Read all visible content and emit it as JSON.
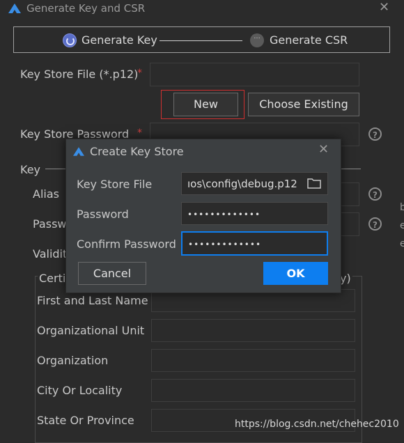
{
  "window": {
    "title": "Generate Key and CSR",
    "close": "✕"
  },
  "steps": [
    {
      "label": "Generate Key",
      "state": "current"
    },
    {
      "label": "Generate CSR",
      "state": "pending",
      "glyph": "···"
    }
  ],
  "form": {
    "keystore_file_label": "Key Store File (*.p12)",
    "required_mark": "*",
    "new_button": "New",
    "choose_existing_button": "Choose Existing",
    "keystore_password_label": "Key Store Password",
    "key_section": "Key",
    "alias_label": "Alias",
    "password_label_partial": "Passw",
    "validity_label_partial": "Validit",
    "cert_section_partial_left": "Certi",
    "cert_section_partial_right": "y)",
    "help_glyph": "?",
    "cert_fields": [
      "First and Last Name",
      "Organizational Unit",
      "Organization",
      "City Or Locality",
      "State Or Province"
    ]
  },
  "dialog": {
    "title": "Create Key Store",
    "close": "✕",
    "keystore_file_label": "Key Store File",
    "keystore_file_value": "ıos\\config\\debug.p12",
    "password_label": "Password",
    "password_value": "•••••••••••••",
    "confirm_label": "Confirm Password",
    "confirm_value": "•••••••••••••",
    "cancel_button": "Cancel",
    "ok_button": "OK"
  },
  "watermark": "https://blog.csdn.net/chehec2010",
  "edge_fragments": [
    "b",
    "e",
    "e"
  ],
  "colors": {
    "accent": "#0d7ef0",
    "highlight_border": "#d03030",
    "required": "#d04040",
    "logo": "#3a8ee6"
  }
}
